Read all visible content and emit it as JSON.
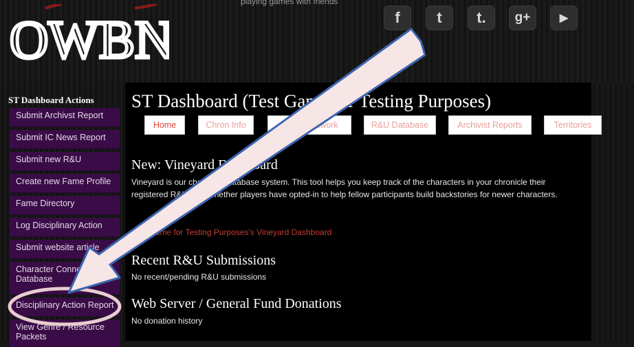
{
  "header": {
    "logo_text": "OWBN",
    "tagline": "playing games with friends",
    "social": [
      {
        "icon": "facebook-icon",
        "glyph": "f"
      },
      {
        "icon": "twitter-icon",
        "glyph": "t"
      },
      {
        "icon": "tumblr-icon",
        "glyph": "t."
      },
      {
        "icon": "google-plus-icon",
        "glyph": "g+"
      },
      {
        "icon": "youtube-icon",
        "glyph": "▶"
      }
    ]
  },
  "sidebar": {
    "title": "ST Dashboard Actions",
    "items": [
      {
        "label": "Submit Archivst Report"
      },
      {
        "label": "Submit IC News Report"
      },
      {
        "label": "Submit new R&U"
      },
      {
        "label": "Create new Fame Profile"
      },
      {
        "label": "Fame Directory"
      },
      {
        "label": "Log Disciplinary Action"
      },
      {
        "label": "Submit website article"
      },
      {
        "label": "Character Connections Database"
      },
      {
        "label": "Disciplinary Action Report"
      },
      {
        "label": "View Genre / Resource Packets"
      }
    ]
  },
  "main": {
    "title": "ST Dashboard (Test Game for Testing Purposes)",
    "tabs": [
      {
        "label": "Home"
      },
      {
        "label": "Chron Info"
      },
      {
        "label": "Chron Network"
      },
      {
        "label": "R&U Database"
      },
      {
        "label": "Archivist Reports"
      },
      {
        "label": "Territories"
      }
    ],
    "vineyard": {
      "heading": "New: Vineyard Dashboard",
      "text": "Vineyard is our character database system. This tool helps you keep track of the characters in your chronicle their registered R&U, and whether players have opted-in to help fellow participants build backstories for newer characters.",
      "link": "Test Game for Testing Purposes's Vineyard Dashboard"
    },
    "ru": {
      "heading": "Recent R&U Submissions",
      "text": "No recent/pending R&U submissions"
    },
    "donations": {
      "heading": "Web Server / General Fund Donations",
      "text": "No donation history"
    }
  },
  "annotation": {
    "arrow_color": "#3c66b0",
    "arrow_fill": "#f7e6e6",
    "ellipse_color": "#e8cdd0"
  }
}
